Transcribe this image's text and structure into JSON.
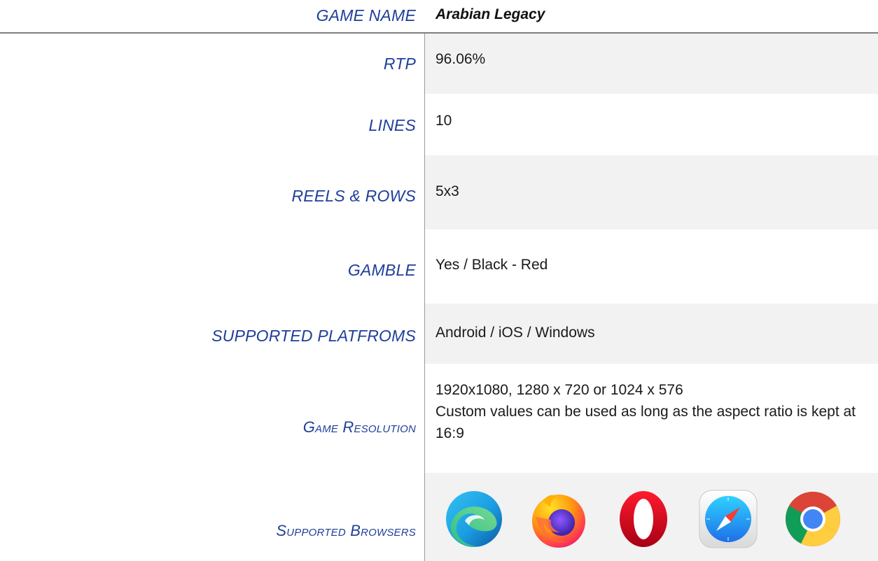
{
  "header": {
    "label": "GAME NAME",
    "value": "Arabian Legacy"
  },
  "rows": [
    {
      "label": "RTP",
      "value": "96.06%"
    },
    {
      "label": "LINES",
      "value": "10"
    },
    {
      "label": "REELS & ROWS",
      "value": "5x3"
    },
    {
      "label": "GAMBLE",
      "value": "Yes / Black - Red"
    },
    {
      "label": "SUPPORTED PLATFROMS",
      "value": "Android / iOS / Windows"
    },
    {
      "label": "Game Resolution",
      "value_line1": "1920x1080, 1280 x 720 or 1024 x 576",
      "value_line2": "Custom values can be used as long as the aspect ratio is kept at 16:9"
    },
    {
      "label": "Supported Browsers",
      "icons": [
        "edge-icon",
        "firefox-icon",
        "opera-icon",
        "safari-icon",
        "chrome-icon"
      ]
    }
  ],
  "colors": {
    "label": "#1f3f99",
    "shade": "#f2f2f2",
    "rule": "#7f7f7f"
  }
}
